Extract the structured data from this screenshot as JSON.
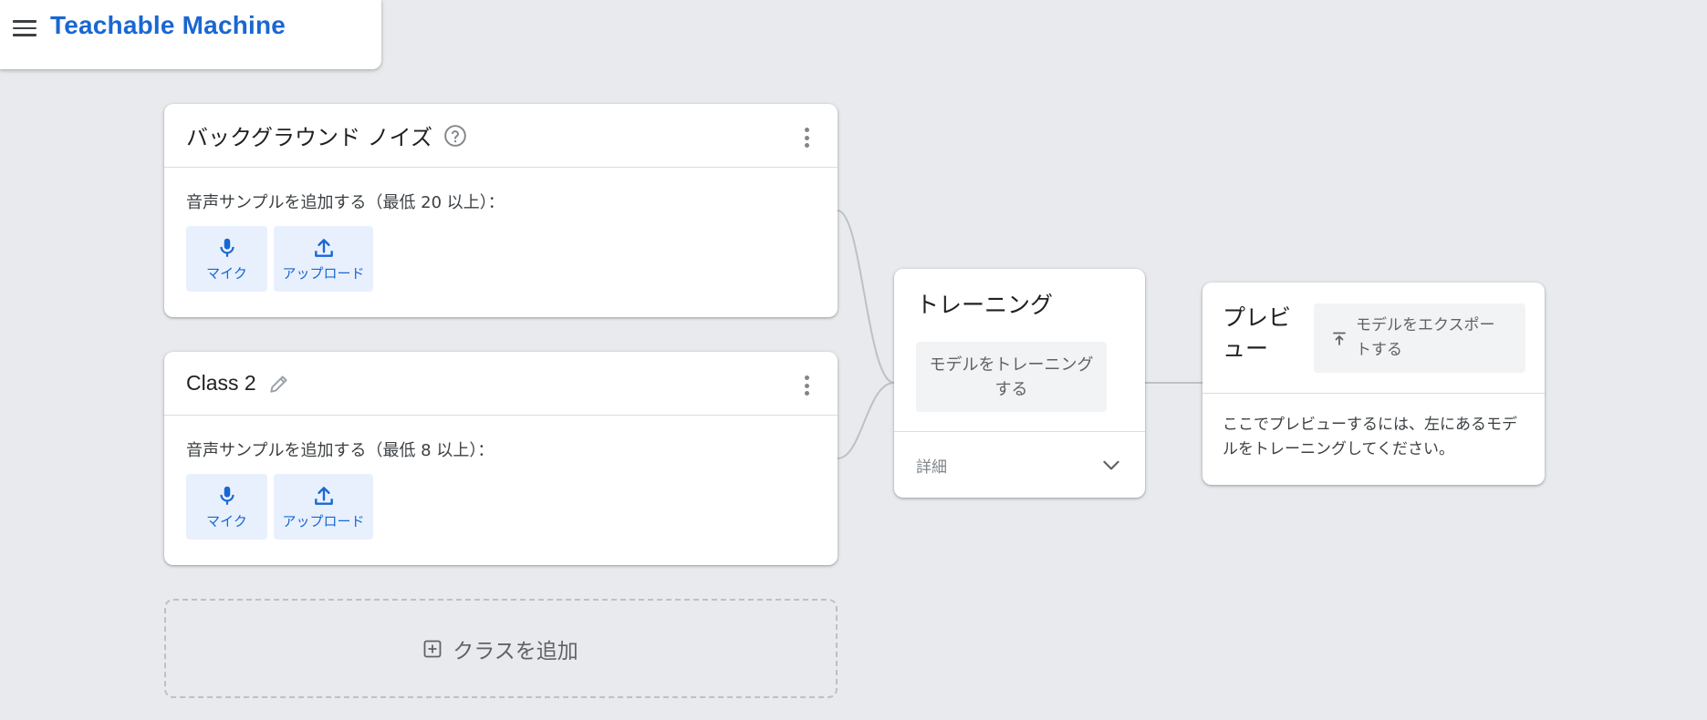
{
  "header": {
    "app_title": "Teachable Machine",
    "menu_icon": "hamburger-menu-icon"
  },
  "classes": [
    {
      "title": "バックグラウンド ノイズ",
      "title_icon": "help-circle-icon",
      "sample_label": "音声サンプルを追加する（最低 20 以上）：",
      "buttons": {
        "mic": "マイク",
        "upload": "アップロード"
      }
    },
    {
      "title": "Class 2",
      "title_icon": "pencil-icon",
      "sample_label": "音声サンプルを追加する（最低 8 以上）：",
      "buttons": {
        "mic": "マイク",
        "upload": "アップロード"
      }
    }
  ],
  "add_class": {
    "label": "クラスを追加",
    "icon": "plus-box-icon"
  },
  "training": {
    "title": "トレーニング",
    "train_button": "モデルをトレーニングする",
    "advanced_label": "詳細",
    "advanced_icon": "chevron-down-icon"
  },
  "preview": {
    "title": "プレビュー",
    "export_button": "モデルをエクスポートする",
    "export_icon": "export-upload-icon",
    "message": "ここでプレビューするには、左にあるモデルをトレーニングしてください。"
  },
  "colors": {
    "background": "#e8eaed",
    "brand_blue": "#1967d2",
    "button_blue_bg": "#e8f0fe",
    "button_gray_bg": "#f1f3f4",
    "connector": "#bdc1c6"
  }
}
